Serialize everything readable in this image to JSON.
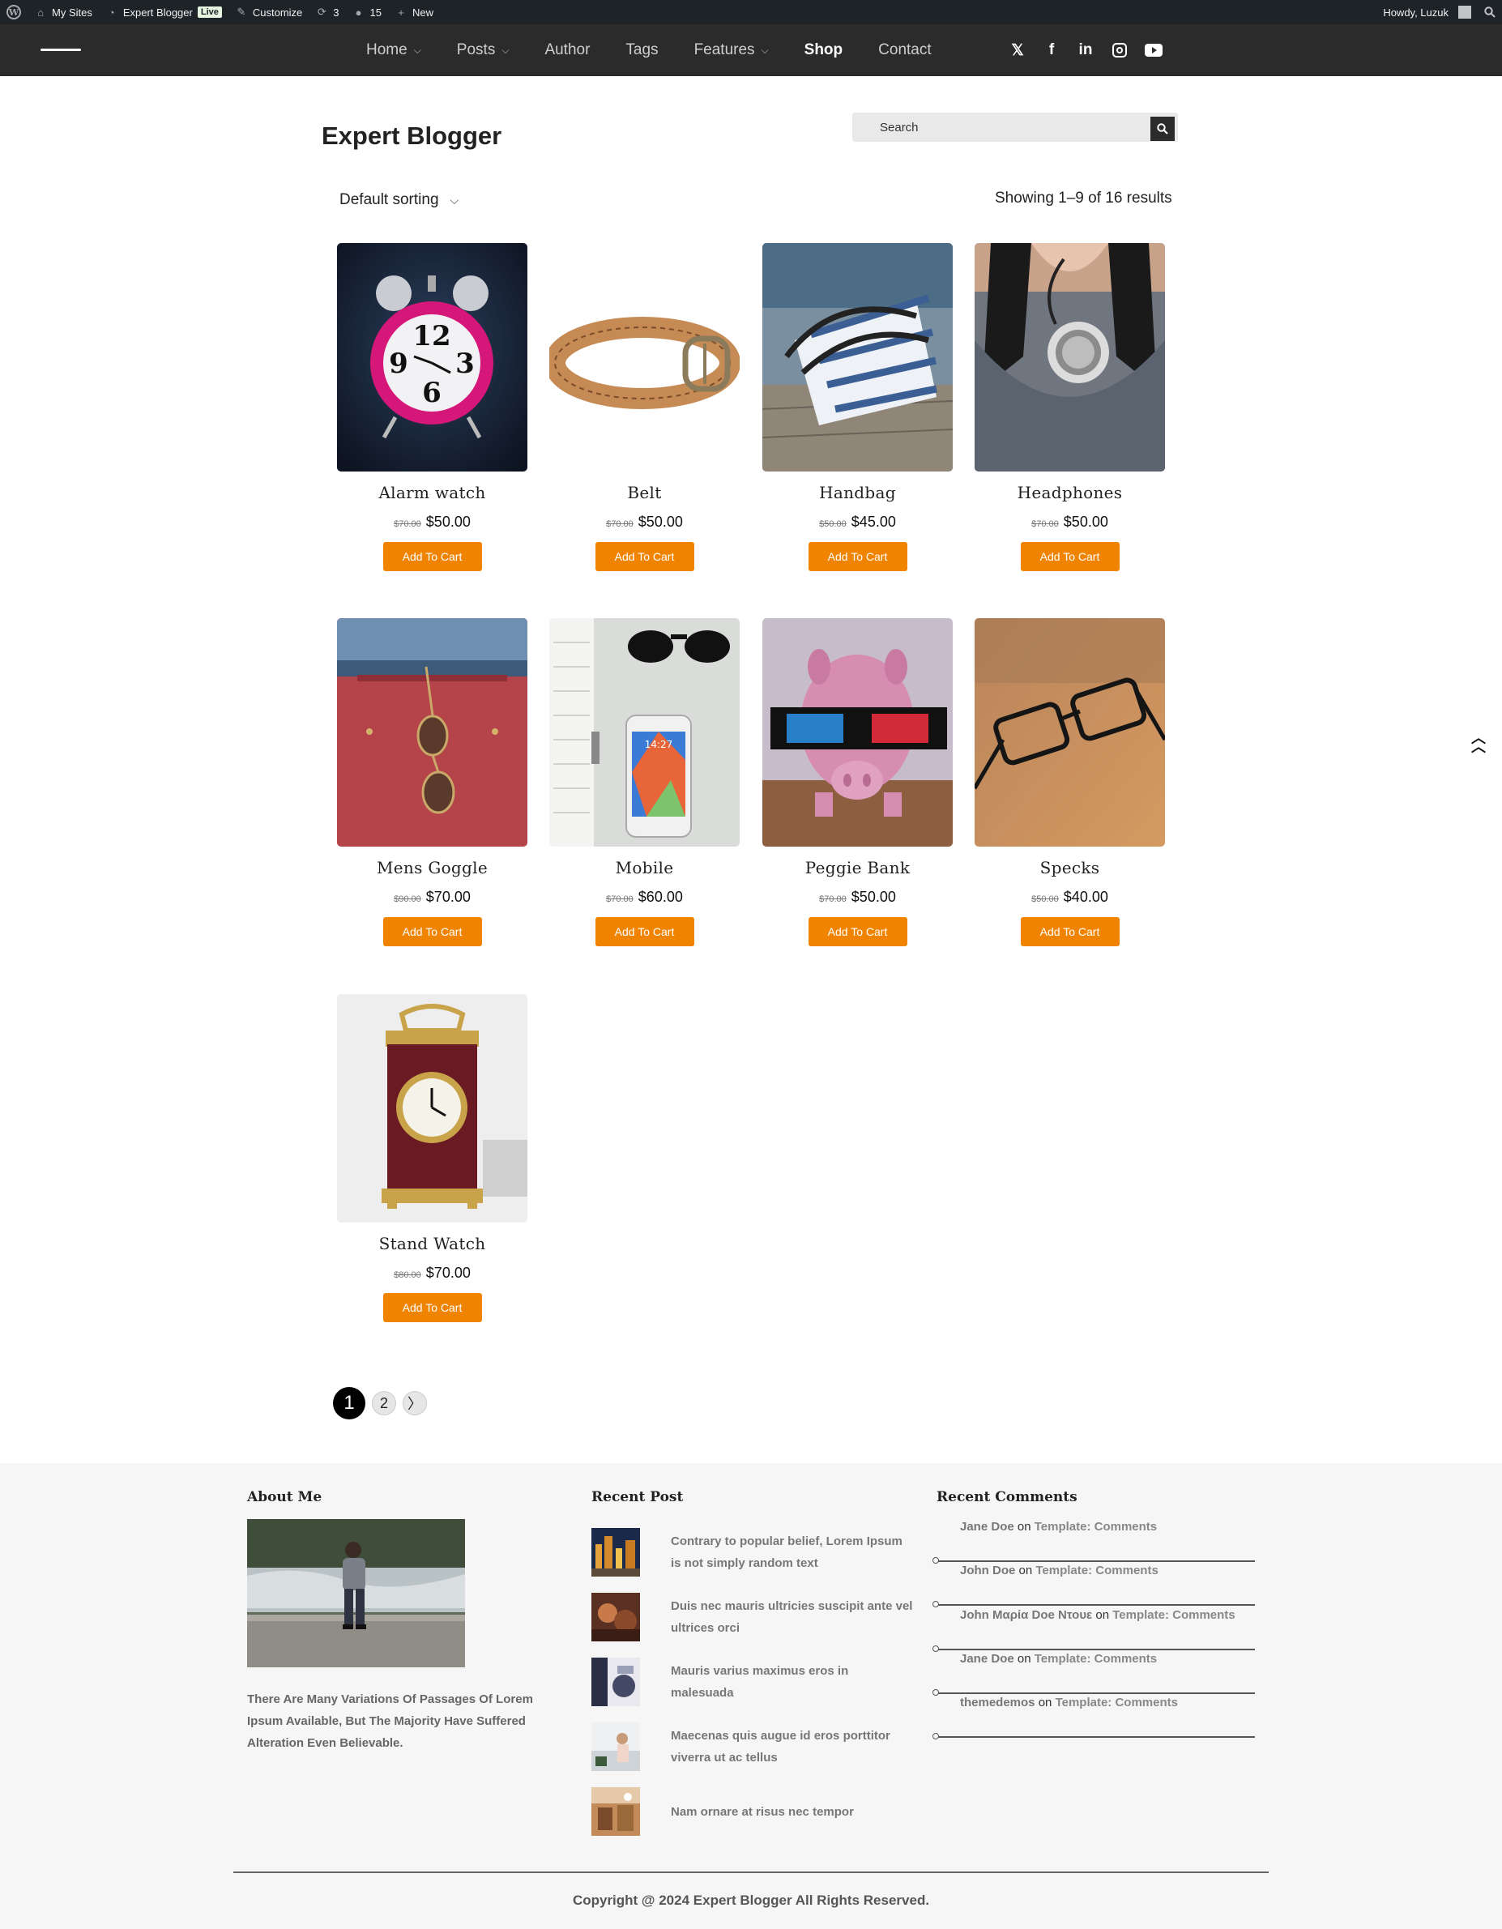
{
  "adminbar": {
    "my_sites": "My Sites",
    "site_name": "Expert Blogger",
    "live_badge": "Live",
    "customize": "Customize",
    "updates_count": "3",
    "comments_count": "15",
    "new_label": "New",
    "howdy": "Howdy, Luzuk"
  },
  "nav": {
    "items": [
      {
        "label": "Home",
        "has_submenu": true
      },
      {
        "label": "Posts",
        "has_submenu": true
      },
      {
        "label": "Author",
        "has_submenu": false
      },
      {
        "label": "Tags",
        "has_submenu": false
      },
      {
        "label": "Features",
        "has_submenu": true
      },
      {
        "label": "Shop",
        "has_submenu": false,
        "active": true
      },
      {
        "label": "Contact",
        "has_submenu": false
      }
    ],
    "socials": [
      {
        "icon": "x-twitter-icon",
        "glyph": "𝕏"
      },
      {
        "icon": "facebook-icon",
        "glyph": "f"
      },
      {
        "icon": "linkedin-icon",
        "glyph": "in"
      },
      {
        "icon": "instagram-icon",
        "glyph": ""
      },
      {
        "icon": "youtube-icon",
        "glyph": ""
      }
    ]
  },
  "header": {
    "site_title": "Expert Blogger",
    "search_placeholder": "Search"
  },
  "shop": {
    "sorting": "Default sorting",
    "result_count": "Showing 1–9 of 16 results",
    "add_to_cart": "Add To Cart",
    "accent_color": "#f08400",
    "products": [
      {
        "name": "Alarm watch",
        "old_price": "$70.00",
        "price": "$50.00",
        "image": "pink-alarm-clock"
      },
      {
        "name": "Belt",
        "old_price": "$70.00",
        "price": "$50.00",
        "image": "braided-leather-belt"
      },
      {
        "name": "Handbag",
        "old_price": "$50.00",
        "price": "$45.00",
        "image": "striped-handbag-on-dock"
      },
      {
        "name": "Headphones",
        "old_price": "$70.00",
        "price": "$50.00",
        "image": "headphones-around-neck"
      },
      {
        "name": "Mens Goggle",
        "old_price": "$90.00",
        "price": "$70.00",
        "image": "aviator-sunglasses-on-red-bag"
      },
      {
        "name": "Mobile",
        "old_price": "$70.00",
        "price": "$60.00",
        "image": "smartphone-notebook-sunglasses"
      },
      {
        "name": "Peggie Bank",
        "old_price": "$70.00",
        "price": "$50.00",
        "image": "piggy-bank-3d-glasses"
      },
      {
        "name": "Specks",
        "old_price": "$50.00",
        "price": "$40.00",
        "image": "eyeglasses-on-wood"
      },
      {
        "name": "Stand Watch",
        "old_price": "$80.00",
        "price": "$70.00",
        "image": "mantel-clock"
      }
    ]
  },
  "pagination": {
    "pages": [
      "1",
      "2"
    ],
    "current": "1",
    "next": "〉"
  },
  "footer": {
    "about": {
      "title": "About Me",
      "text": "There Are Many Variations Of Passages Of Lorem Ipsum Available, But The Majority Have Suffered Alteration Even Believable."
    },
    "recent_posts": {
      "title": "Recent Post",
      "items": [
        "Contrary to popular belief, Lorem Ipsum is not simply random text",
        "Duis nec mauris ultricies suscipit ante vel ultrices orci",
        "Mauris varius maximus eros in malesuada",
        "Maecenas quis augue id eros porttitor viverra ut ac tellus",
        "Nam ornare at risus nec tempor"
      ]
    },
    "recent_comments": {
      "title": "Recent Comments",
      "on_word": "on",
      "items": [
        {
          "author": "Jane Doe",
          "post": "Template: Comments"
        },
        {
          "author": "John Doe",
          "post": "Template: Comments"
        },
        {
          "author": "John Μαρία Doe Ντουε",
          "post": "Template: Comments"
        },
        {
          "author": "Jane Doe",
          "post": "Template: Comments"
        },
        {
          "author": "themedemos",
          "post": "Template: Comments"
        }
      ]
    },
    "copyright": "Copyright @ 2024 Expert Blogger All Rights Reserved."
  }
}
